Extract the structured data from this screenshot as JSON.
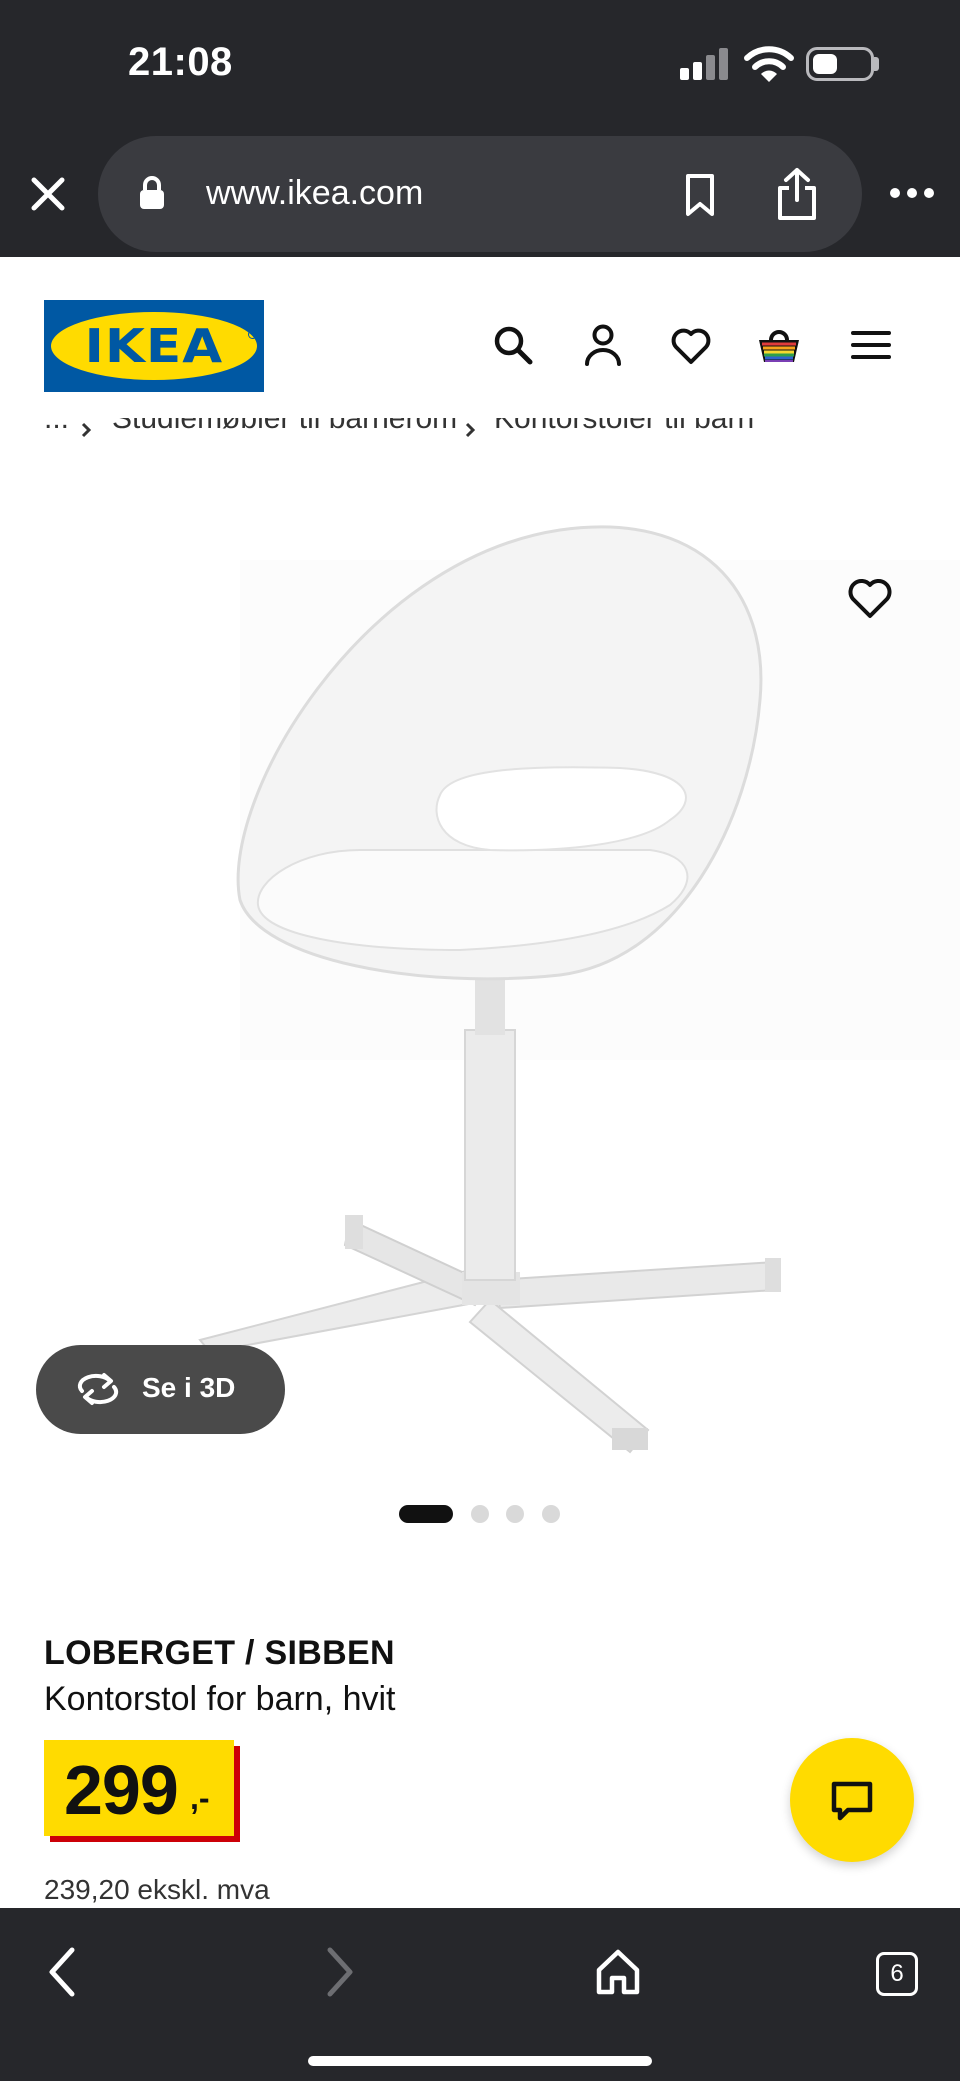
{
  "status_bar": {
    "time": "21:08"
  },
  "browser": {
    "url": "www.ikea.com",
    "tabs_count": "6"
  },
  "brand": {
    "logo_text": "IKEA"
  },
  "breadcrumb": {
    "ellipsis": "...",
    "items": [
      "Studiemøbler til barnerom",
      "Kontorstoler til barn"
    ]
  },
  "product": {
    "view_3d_label": "Se i 3D",
    "image_count": 4,
    "active_image": 1,
    "name": "LOBERGET / SIBBEN",
    "description": "Kontorstol for barn, hvit",
    "price": "299",
    "price_suffix": ",-",
    "price_ex_vat": "239,20 ekskl. mva"
  },
  "colors": {
    "ikea_blue": "#0058a3",
    "ikea_yellow": "#ffdb00",
    "price_red": "#cc0008",
    "chrome_dark": "#26272b"
  }
}
